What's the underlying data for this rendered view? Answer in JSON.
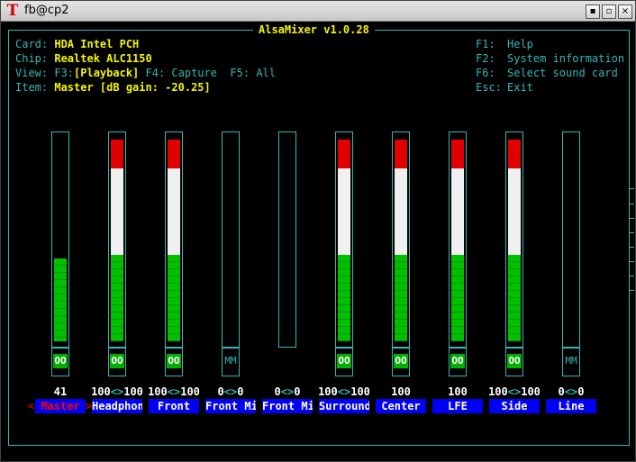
{
  "window": {
    "title": "fb@cp2",
    "icon": "terminal-icon",
    "min_glyph": "▪",
    "max_glyph": "▫",
    "close_glyph": "×"
  },
  "app_title": "AlsaMixer v1.0.28",
  "info": {
    "card_label": "Card: ",
    "card_value": "HDA Intel PCH",
    "chip_label": "Chip: ",
    "chip_value": "Realtek ALC1150",
    "view_label": "View: F3:",
    "view_playback": "[Playback]",
    "view_rest": " F4: Capture  F5: All",
    "item_label": "Item: ",
    "item_value": "Master [dB gain: -20.25]"
  },
  "help": [
    {
      "key": "F1:",
      "text": "Help"
    },
    {
      "key": "F2:",
      "text": "System information"
    },
    {
      "key": "F6:",
      "text": "Select sound card"
    },
    {
      "key": "Esc:",
      "text": "Exit"
    }
  ],
  "colors": {
    "accent": "#36b5b5",
    "red": "#e00000",
    "white": "#f0f0f0",
    "green": "#00c000",
    "name_bg": "#0000f4",
    "yellow": "#f4f400"
  },
  "channels": [
    {
      "name": "Master",
      "level": 41,
      "volume": "41",
      "switch": "OO",
      "selected": true
    },
    {
      "name": "Headphon",
      "level": 100,
      "volume": "100<>100",
      "switch": "OO"
    },
    {
      "name": "Front",
      "level": 100,
      "volume": "100<>100",
      "switch": "OO"
    },
    {
      "name": "Front Mi",
      "level": 0,
      "volume": "0<>0",
      "switch": "MM"
    },
    {
      "name": "Front Mi",
      "level": 0,
      "volume": "0<>0",
      "switch": ""
    },
    {
      "name": "Surround",
      "level": 100,
      "volume": "100<>100",
      "switch": "OO"
    },
    {
      "name": "Center",
      "level": 100,
      "volume": "100",
      "switch": "OO"
    },
    {
      "name": "LFE",
      "level": 100,
      "volume": "100",
      "switch": "OO"
    },
    {
      "name": "Side",
      "level": 100,
      "volume": "100<>100",
      "switch": "OO"
    },
    {
      "name": "Line",
      "level": 0,
      "volume": "0<>0",
      "switch": "MM"
    }
  ],
  "selection_marks": {
    "left": "<",
    "right": ">"
  }
}
